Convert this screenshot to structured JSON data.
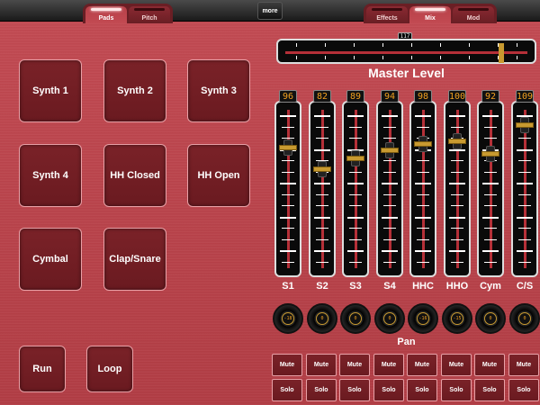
{
  "tabs_left": [
    {
      "label": "Pads",
      "active": true
    },
    {
      "label": "Pitch",
      "active": false
    }
  ],
  "tabs_right": [
    {
      "label": "Effects",
      "active": false
    },
    {
      "label": "Mix",
      "active": true
    },
    {
      "label": "Mod",
      "active": false
    }
  ],
  "more_label": "more",
  "pads": [
    "Synth 1",
    "Synth 2",
    "Synth 3",
    "Synth 4",
    "HH Closed",
    "HH Open",
    "Cymbal",
    "Clap/Snare"
  ],
  "transport": {
    "run_label": "Run",
    "loop_label": "Loop"
  },
  "master": {
    "label": "Master Level",
    "value": "117",
    "level": 0.9
  },
  "channels": [
    {
      "name": "S1",
      "value": "96",
      "pan": "-18",
      "fader": 0.78
    },
    {
      "name": "S2",
      "value": "82",
      "pan": "0",
      "fader": 0.64
    },
    {
      "name": "S3",
      "value": "89",
      "pan": "0",
      "fader": 0.71
    },
    {
      "name": "S4",
      "value": "94",
      "pan": "0",
      "fader": 0.76
    },
    {
      "name": "HHC",
      "value": "98",
      "pan": "-16",
      "fader": 0.8
    },
    {
      "name": "HHO",
      "value": "100",
      "pan": "-15",
      "fader": 0.82
    },
    {
      "name": "Cym",
      "value": "92",
      "pan": "0",
      "fader": 0.74
    },
    {
      "name": "C/S",
      "value": "109",
      "pan": "0",
      "fader": 0.92
    }
  ],
  "pan_label": "Pan",
  "mute_label": "Mute",
  "solo_label": "Solo"
}
